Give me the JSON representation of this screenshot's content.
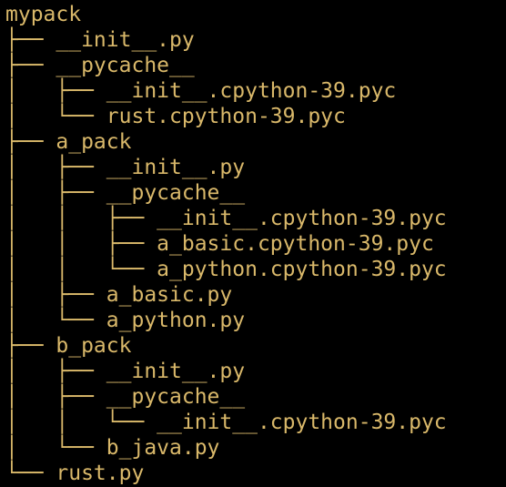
{
  "colors": {
    "background": "#000000",
    "text": "#d9b86a"
  },
  "tree": {
    "lines": [
      {
        "prefix": "",
        "name": "mypack"
      },
      {
        "prefix": "├── ",
        "name": "__init__.py"
      },
      {
        "prefix": "├── ",
        "name": "__pycache__"
      },
      {
        "prefix": "│   ├── ",
        "name": "__init__.cpython-39.pyc"
      },
      {
        "prefix": "│   └── ",
        "name": "rust.cpython-39.pyc"
      },
      {
        "prefix": "├── ",
        "name": "a_pack"
      },
      {
        "prefix": "│   ├── ",
        "name": "__init__.py"
      },
      {
        "prefix": "│   ├── ",
        "name": "__pycache__"
      },
      {
        "prefix": "│   │   ├── ",
        "name": "__init__.cpython-39.pyc"
      },
      {
        "prefix": "│   │   ├── ",
        "name": "a_basic.cpython-39.pyc"
      },
      {
        "prefix": "│   │   └── ",
        "name": "a_python.cpython-39.pyc"
      },
      {
        "prefix": "│   ├── ",
        "name": "a_basic.py"
      },
      {
        "prefix": "│   └── ",
        "name": "a_python.py"
      },
      {
        "prefix": "├── ",
        "name": "b_pack"
      },
      {
        "prefix": "│   ├── ",
        "name": "__init__.py"
      },
      {
        "prefix": "│   ├── ",
        "name": "__pycache__"
      },
      {
        "prefix": "│   │   └── ",
        "name": "__init__.cpython-39.pyc"
      },
      {
        "prefix": "│   └── ",
        "name": "b_java.py"
      },
      {
        "prefix": "└── ",
        "name": "rust.py"
      }
    ]
  }
}
